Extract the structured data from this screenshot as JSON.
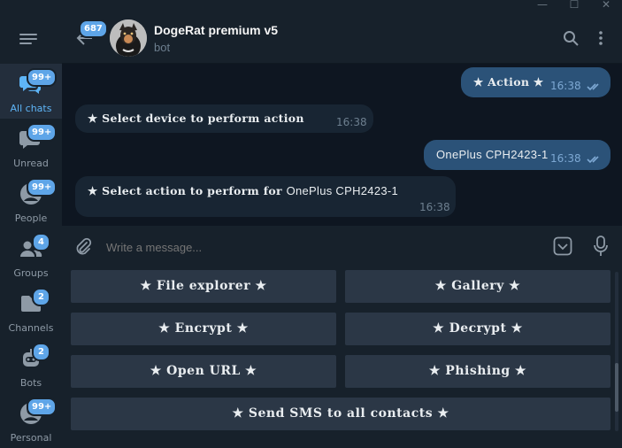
{
  "window": {
    "minimize_glyph": "—",
    "maximize_glyph": "☐",
    "close_glyph": "✕"
  },
  "sidebar": {
    "folders": [
      {
        "label": "All chats",
        "badge": "99+",
        "icon": "chat-bubbles-icon",
        "active": true
      },
      {
        "label": "Unread",
        "badge": "99+",
        "icon": "chat-bubble-icon",
        "active": false
      },
      {
        "label": "People",
        "badge": "99+",
        "icon": "person-icon",
        "active": false
      },
      {
        "label": "Groups",
        "badge": "4",
        "icon": "group-icon",
        "active": false
      },
      {
        "label": "Channels",
        "badge": "2",
        "icon": "folder-icon",
        "active": false
      },
      {
        "label": "Bots",
        "badge": "2",
        "icon": "bot-icon",
        "active": false
      },
      {
        "label": "Personal",
        "badge": "99+",
        "icon": "person-icon",
        "active": false
      }
    ]
  },
  "header": {
    "back_badge": "687",
    "chat_title": "DogeRat premium v5",
    "chat_subtitle": "bot",
    "icons": [
      "back-arrow-icon",
      "search-icon",
      "more-vertical-icon"
    ]
  },
  "messages": [
    {
      "direction": "out",
      "text": "★ Action ★",
      "time": "16:38",
      "read": true
    },
    {
      "direction": "in",
      "text": "★ Select device to perform action",
      "time": "16:38"
    },
    {
      "direction": "out",
      "text": "OnePlus CPH2423-1",
      "time": "16:38",
      "read": true
    },
    {
      "direction": "in",
      "text_prefix": "★ Select action to perform for ",
      "text_device": "OnePlus CPH2423-1",
      "time": "16:38"
    }
  ],
  "composer": {
    "placeholder": "Write a message...",
    "icons": [
      "attach-icon",
      "bot-keyboard-icon",
      "microphone-icon"
    ]
  },
  "keyboard": {
    "buttons": [
      "★ File explorer ★",
      "★ Gallery ★",
      "★ Encrypt ★",
      "★ Decrypt ★",
      "★ Open URL ★",
      "★ Phishing ★",
      "★ Send SMS to all contacts ★"
    ]
  },
  "colors": {
    "accent": "#5eb5f7",
    "badge": "#5ea5e8",
    "bubble_out": "#2b5278",
    "bubble_in": "#182533",
    "chat_bg": "#0e1621",
    "panel": "#17212b",
    "keyboard_button": "#2b3746"
  }
}
